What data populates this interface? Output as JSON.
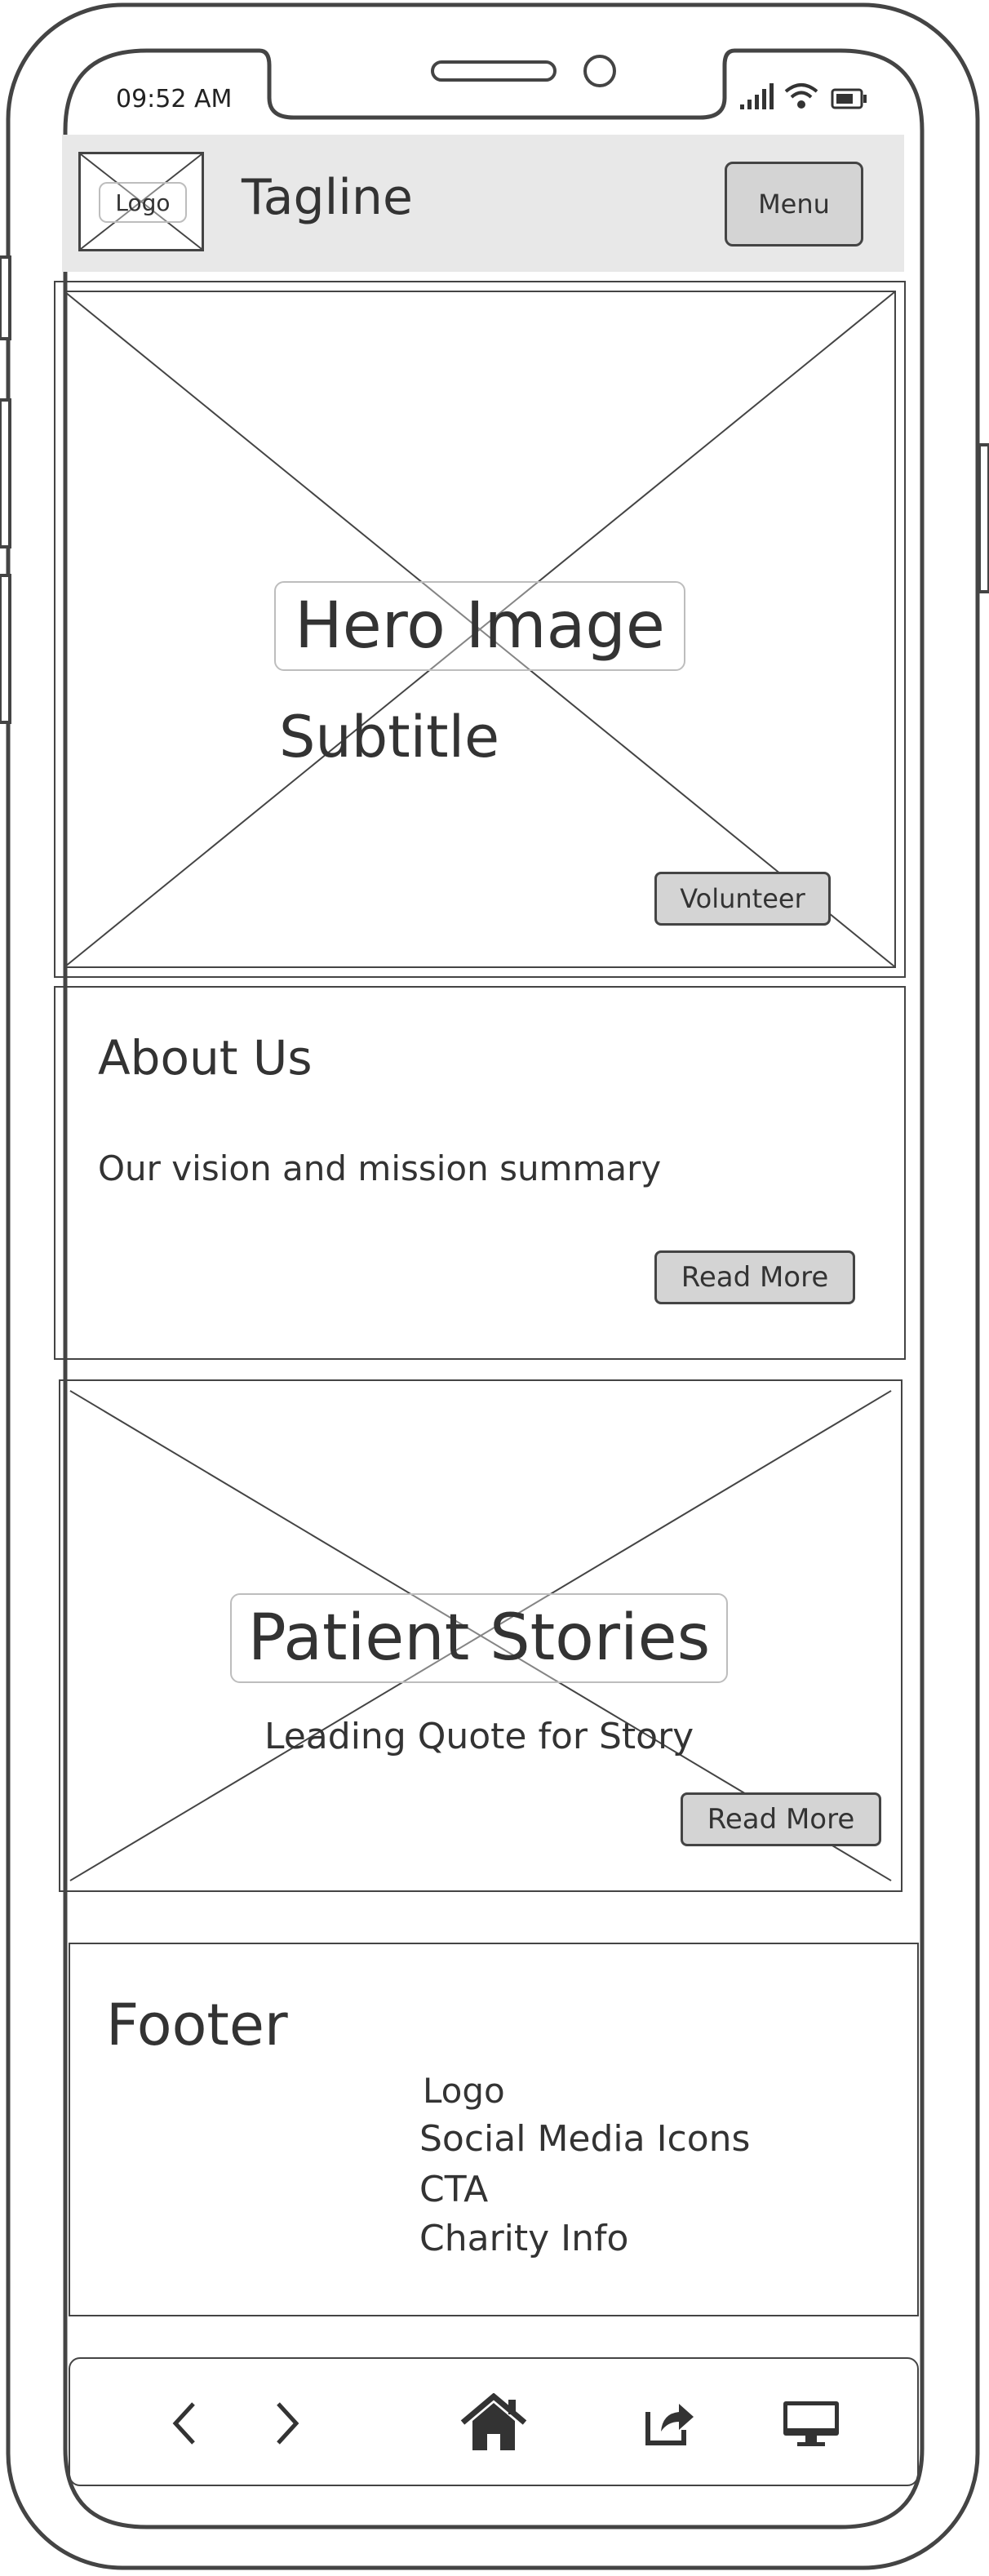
{
  "status_bar": {
    "time": "09:52 AM"
  },
  "header": {
    "logo_label": "Logo",
    "tagline": "Tagline",
    "menu_label": "Menu"
  },
  "hero": {
    "title": "Hero Image",
    "subtitle": "Subtitle",
    "cta_label": "Volunteer"
  },
  "about": {
    "heading": "About Us",
    "body": "Our vision and mission summary",
    "cta_label": "Read More"
  },
  "stories": {
    "title": "Patient Stories",
    "quote": "Leading Quote for Story",
    "cta_label": "Read More"
  },
  "footer": {
    "heading": "Footer",
    "items": [
      "Logo",
      "Social Media Icons",
      "CTA",
      "Charity Info"
    ]
  },
  "browser_bar": {
    "icons": [
      "back-icon",
      "forward-icon",
      "home-icon",
      "share-icon",
      "desktop-icon"
    ]
  },
  "colors": {
    "stroke": "#444444",
    "header_bg": "#e8e8e8",
    "button_bg": "#d4d4d4",
    "label_border": "#bdbdbd"
  }
}
